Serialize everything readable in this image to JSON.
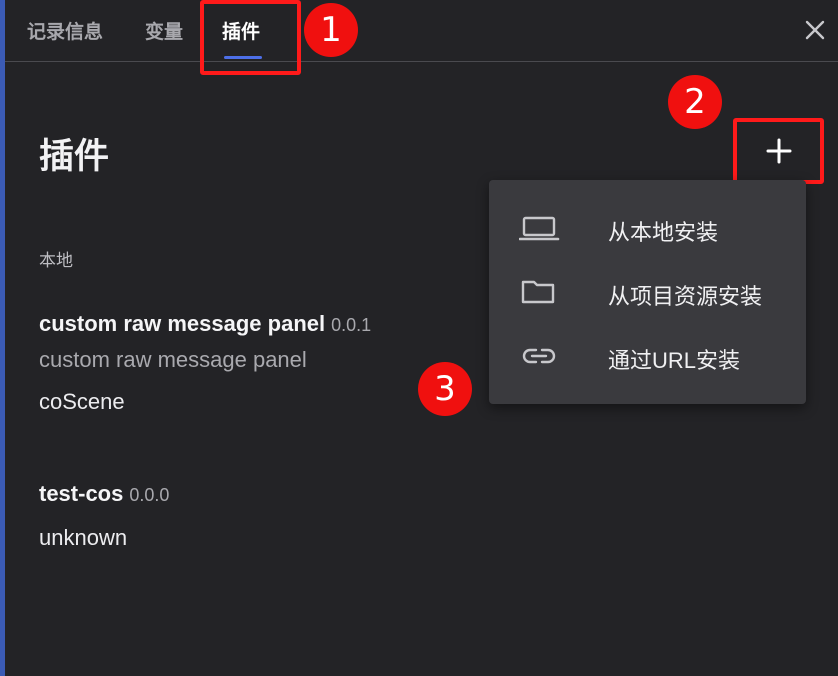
{
  "tabs": [
    {
      "label": "记录信息",
      "active": false
    },
    {
      "label": "变量",
      "active": false
    },
    {
      "label": "插件",
      "active": true
    }
  ],
  "page_title": "插件",
  "section_label": "本地",
  "plugins": [
    {
      "name": "custom raw message panel",
      "version": "0.0.1",
      "description": "custom raw message panel",
      "author": "coScene"
    },
    {
      "name": "test-cos",
      "version": "0.0.0",
      "author": "unknown"
    }
  ],
  "menu": {
    "items": [
      {
        "label": "从本地安装",
        "icon": "laptop-icon"
      },
      {
        "label": "从项目资源安装",
        "icon": "folder-icon"
      },
      {
        "label": "通过URL安装",
        "icon": "link-icon"
      }
    ]
  },
  "annotations": [
    "1",
    "2",
    "3"
  ],
  "colors": {
    "background": "#232326",
    "accent": "#4d6fe8",
    "highlight": "#ff1a1a",
    "menu": "#3a3a3e"
  }
}
